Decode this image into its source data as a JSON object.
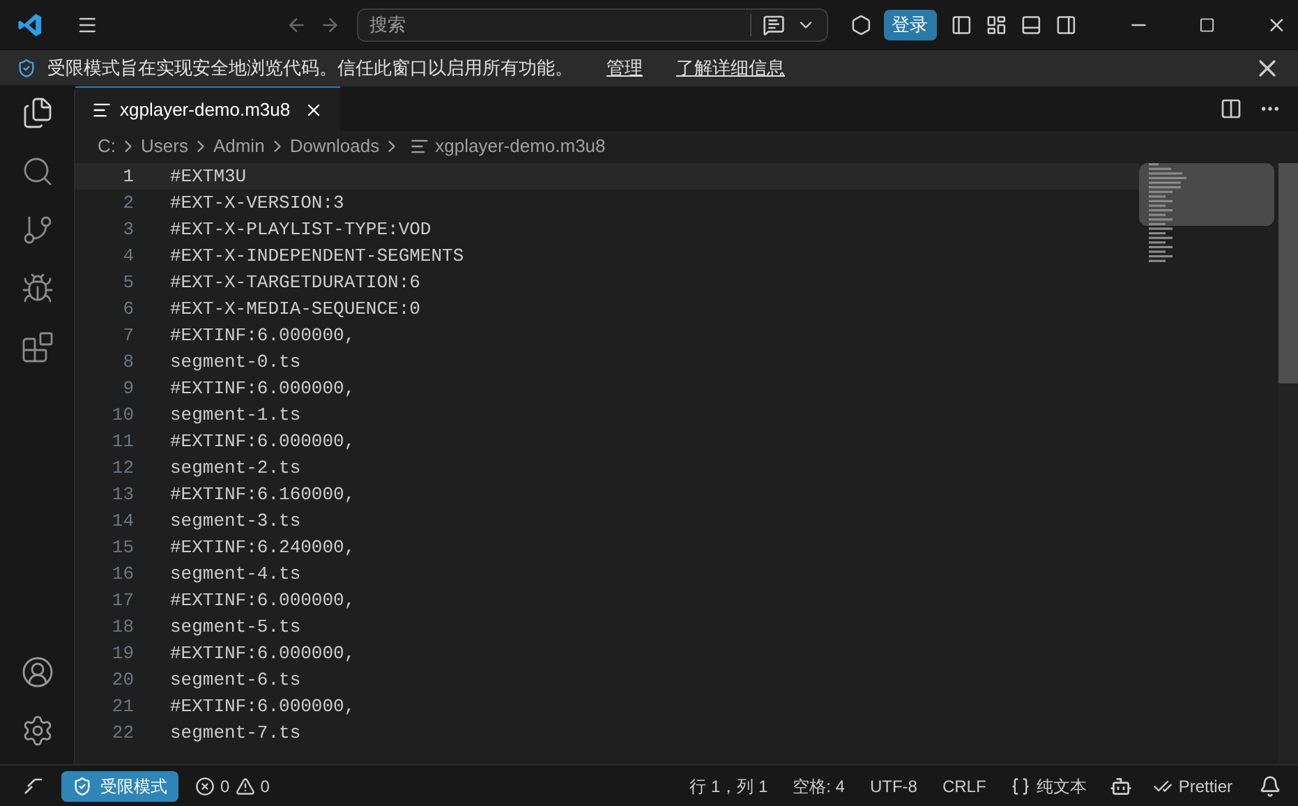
{
  "titlebar": {
    "search_placeholder": "搜索",
    "login": "登录"
  },
  "banner": {
    "message": "受限模式旨在实现安全地浏览代码。信任此窗口以启用所有功能。",
    "links": [
      "管理",
      "了解详细信息"
    ]
  },
  "activity_bar": {
    "items": [
      {
        "kind": "files",
        "selected": true
      },
      {
        "kind": "search",
        "selected": false
      },
      {
        "kind": "scm",
        "selected": false
      },
      {
        "kind": "debug",
        "selected": false
      },
      {
        "kind": "extensions",
        "selected": false
      }
    ]
  },
  "tabs": [
    {
      "label": "xgplayer-demo.m3u8",
      "selected": true
    }
  ],
  "breadcrumbs": [
    "C:",
    "Users",
    "Admin",
    "Downloads",
    "xgplayer-demo.m3u8"
  ],
  "editor": {
    "lines": [
      {
        "number": "1",
        "text": "#EXTM3U",
        "current": true
      },
      {
        "number": "2",
        "text": "#EXT-X-VERSION:3",
        "current": false
      },
      {
        "number": "3",
        "text": "#EXT-X-PLAYLIST-TYPE:VOD",
        "current": false
      },
      {
        "number": "4",
        "text": "#EXT-X-INDEPENDENT-SEGMENTS",
        "current": false
      },
      {
        "number": "5",
        "text": "#EXT-X-TARGETDURATION:6",
        "current": false
      },
      {
        "number": "6",
        "text": "#EXT-X-MEDIA-SEQUENCE:0",
        "current": false
      },
      {
        "number": "7",
        "text": "#EXTINF:6.000000,",
        "current": false
      },
      {
        "number": "8",
        "text": "segment-0.ts",
        "current": false
      },
      {
        "number": "9",
        "text": "#EXTINF:6.000000,",
        "current": false
      },
      {
        "number": "10",
        "text": "segment-1.ts",
        "current": false
      },
      {
        "number": "11",
        "text": "#EXTINF:6.000000,",
        "current": false
      },
      {
        "number": "12",
        "text": "segment-2.ts",
        "current": false
      },
      {
        "number": "13",
        "text": "#EXTINF:6.160000,",
        "current": false
      },
      {
        "number": "14",
        "text": "segment-3.ts",
        "current": false
      },
      {
        "number": "15",
        "text": "#EXTINF:6.240000,",
        "current": false
      },
      {
        "number": "16",
        "text": "segment-4.ts",
        "current": false
      },
      {
        "number": "17",
        "text": "#EXTINF:6.000000,",
        "current": false
      },
      {
        "number": "18",
        "text": "segment-5.ts",
        "current": false
      },
      {
        "number": "19",
        "text": "#EXTINF:6.000000,",
        "current": false
      },
      {
        "number": "20",
        "text": "segment-6.ts",
        "current": false
      },
      {
        "number": "21",
        "text": "#EXTINF:6.000000,",
        "current": false
      },
      {
        "number": "22",
        "text": "segment-7.ts",
        "current": false
      }
    ]
  },
  "status_bar": {
    "mode": "受限模式",
    "errors": "0",
    "warnings": "0",
    "items": [
      "行 1，列 1",
      "空格: 4",
      "UTF-8",
      "CRLF"
    ],
    "language": "纯文本",
    "formatter": "Prettier"
  }
}
